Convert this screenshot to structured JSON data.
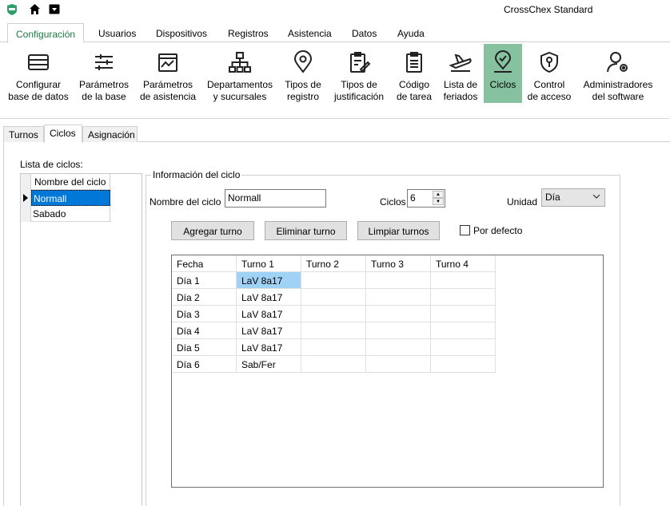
{
  "app": {
    "title": "CrossChex Standard"
  },
  "titlebar": {
    "icons": [
      "app-logo-icon",
      "home-icon",
      "download-icon"
    ]
  },
  "menu_tabs": [
    {
      "label": "Configuración",
      "active": true
    },
    {
      "label": "Usuarios"
    },
    {
      "label": "Dispositivos"
    },
    {
      "label": "Registros"
    },
    {
      "label": "Asistencia"
    },
    {
      "label": "Datos"
    },
    {
      "label": "Ayuda"
    }
  ],
  "ribbon": [
    {
      "label": "Configurar\nbase de datos",
      "icon": "database-card-icon"
    },
    {
      "label": "Parámetros\nde la base",
      "icon": "sliders-icon"
    },
    {
      "label": "Parámetros\nde asistencia",
      "icon": "calendar-chart-icon"
    },
    {
      "label": "Departamentos\ny sucursales",
      "icon": "org-chart-icon"
    },
    {
      "label": "Tipos de\nregistro",
      "icon": "map-pin-icon"
    },
    {
      "label": "Tipos de\njustificación",
      "icon": "clipboard-pen-icon"
    },
    {
      "label": "Código\nde tarea",
      "icon": "clipboard-list-icon"
    },
    {
      "label": "Lista de\nferiados",
      "icon": "plane-icon"
    },
    {
      "label": "Ciclos",
      "icon": "pin-check-icon",
      "active": true
    },
    {
      "label": "Control\nde acceso",
      "icon": "shield-key-icon"
    },
    {
      "label": "Administradores\ndel software",
      "icon": "user-gear-icon"
    }
  ],
  "sub_tabs": [
    {
      "label": "Turnos"
    },
    {
      "label": "Ciclos",
      "active": true
    },
    {
      "label": "Asignación"
    }
  ],
  "lista": {
    "label": "Lista de ciclos:",
    "header": "Nombre del ciclo",
    "rows": [
      "Normall",
      "Sabado"
    ]
  },
  "info": {
    "legend": "Información del ciclo",
    "nombre_label": "Nombre del ciclo",
    "nombre_value": "Normall",
    "ciclos_label": "Ciclos",
    "ciclos_value": "6",
    "unidad_label": "Unidad",
    "unidad_value": "Día",
    "btn_agregar": "Agregar turno",
    "btn_eliminar": "Eliminar turno",
    "btn_limpiar": "Limpiar turnos",
    "por_defecto": "Por defecto"
  },
  "grid": {
    "headers": [
      "Fecha",
      "Turno 1",
      "Turno 2",
      "Turno 3",
      "Turno 4"
    ],
    "rows": [
      [
        "Día 1",
        "LaV 8a17",
        "",
        "",
        ""
      ],
      [
        "Día 2",
        "LaV 8a17",
        "",
        "",
        ""
      ],
      [
        "Día 3",
        "LaV 8a17",
        "",
        "",
        ""
      ],
      [
        "Día 4",
        "LaV 8a17",
        "",
        "",
        ""
      ],
      [
        "Día 5",
        "LaV 8a17",
        "",
        "",
        ""
      ],
      [
        "Día 6",
        "Sab/Fer",
        "",
        "",
        ""
      ]
    ]
  },
  "colors": {
    "accent": "#86c1a0",
    "tab_active_text": "#1e7a3e",
    "selection": "#0078d7",
    "cell_selection": "#9fd2f5"
  }
}
